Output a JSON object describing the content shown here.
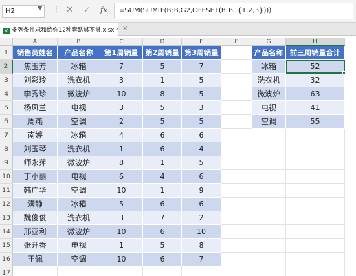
{
  "formula_bar": {
    "name_box": "H2",
    "cancel_icon": "✕",
    "enter_icon": "✓",
    "fx_label": "fx",
    "formula": "=SUM(SUMIF(B:B,G2,OFFSET(B:B,,{1,2,3})))"
  },
  "document": {
    "tab_icon": "X",
    "tab_title": "多列条件求和给你12种套路够不够.xlsx *",
    "close_icon": "×"
  },
  "columns": [
    "A",
    "B",
    "C",
    "D",
    "E",
    "F",
    "G",
    "H"
  ],
  "rows": [
    "1",
    "2",
    "3",
    "4",
    "5",
    "6",
    "7",
    "8",
    "9",
    "10",
    "11",
    "12",
    "13",
    "14",
    "15",
    "16",
    "17"
  ],
  "active_cell": "H2",
  "main_table": {
    "headers": [
      "销售员姓名",
      "产品名称",
      "第1周销量",
      "第2周销量",
      "第3周销量"
    ],
    "rows": [
      [
        "焦玉芳",
        "冰箱",
        "7",
        "5",
        "7"
      ],
      [
        "刘彩玲",
        "洗衣机",
        "3",
        "1",
        "5"
      ],
      [
        "李秀珍",
        "微波炉",
        "10",
        "8",
        "5"
      ],
      [
        "杨凤兰",
        "电视",
        "3",
        "5",
        "3"
      ],
      [
        "周燕",
        "空调",
        "2",
        "5",
        "5"
      ],
      [
        "南婷",
        "冰箱",
        "4",
        "6",
        "6"
      ],
      [
        "刘玉琴",
        "洗衣机",
        "1",
        "6",
        "4"
      ],
      [
        "师永萍",
        "微波炉",
        "8",
        "1",
        "5"
      ],
      [
        "丁小丽",
        "电视",
        "6",
        "4",
        "6"
      ],
      [
        "韩广华",
        "空调",
        "10",
        "1",
        "9"
      ],
      [
        "满静",
        "冰箱",
        "5",
        "6",
        "6"
      ],
      [
        "魏俊俊",
        "洗衣机",
        "3",
        "7",
        "2"
      ],
      [
        "邢亚利",
        "微波炉",
        "10",
        "6",
        "10"
      ],
      [
        "张开香",
        "电视",
        "1",
        "5",
        "8"
      ],
      [
        "王佩",
        "空调",
        "10",
        "6",
        "7"
      ]
    ]
  },
  "summary_table": {
    "headers": [
      "产品名称",
      "前三周销量合计"
    ],
    "rows": [
      [
        "冰箱",
        "52"
      ],
      [
        "洗衣机",
        "32"
      ],
      [
        "微波炉",
        "63"
      ],
      [
        "电视",
        "41"
      ],
      [
        "空调",
        "55"
      ]
    ]
  },
  "colors": {
    "header_fill": "#4472c4",
    "band_dark": "#cdd8ee",
    "band_light": "#e8edf7",
    "selection": "#217346"
  }
}
